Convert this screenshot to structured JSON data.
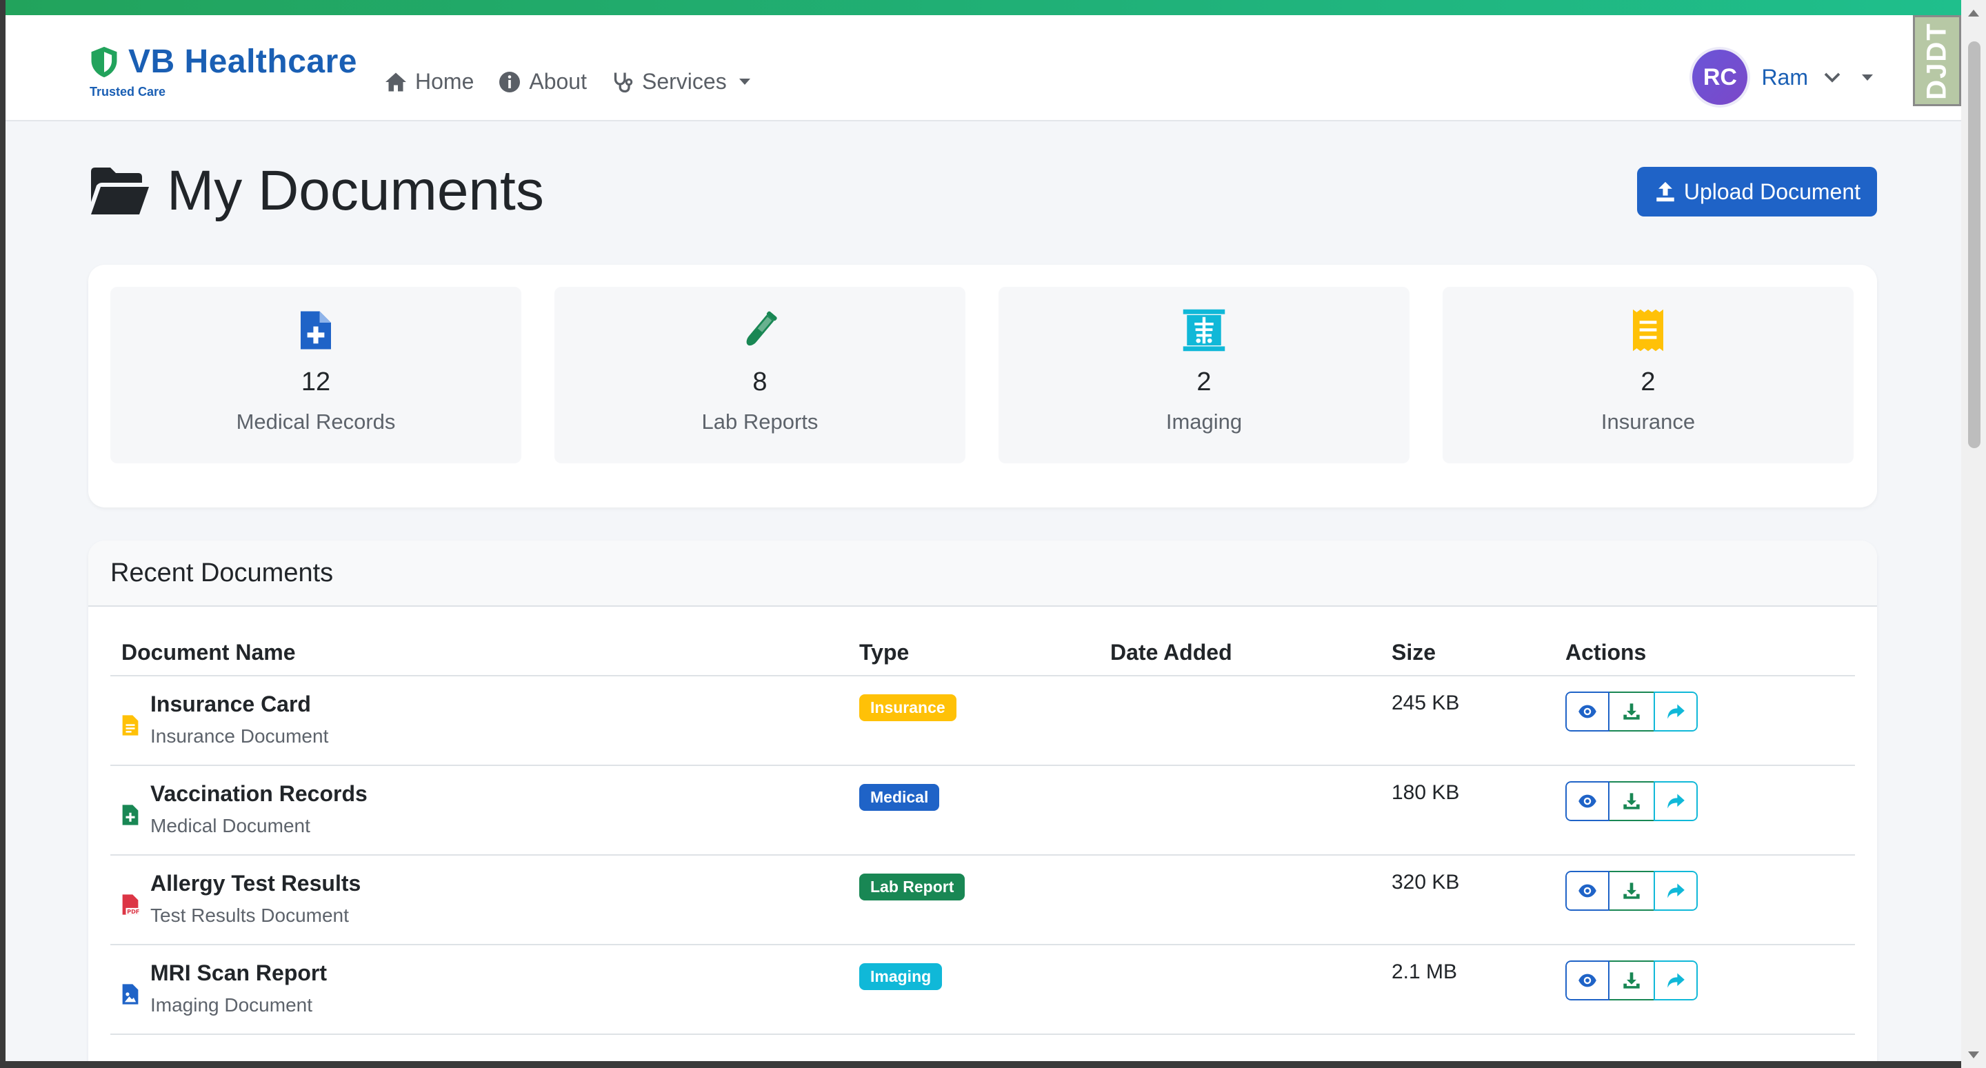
{
  "brand": {
    "name": "VB Healthcare",
    "tagline": "Trusted Care"
  },
  "nav": {
    "home": "Home",
    "about": "About",
    "services": "Services"
  },
  "user": {
    "initials": "RC",
    "name": "Ram"
  },
  "extension_badge": "DJDT",
  "page": {
    "title": "My Documents",
    "upload_label": "Upload Document"
  },
  "stats": [
    {
      "count": "12",
      "label": "Medical Records",
      "icon": "file-medical-icon",
      "color": "#1f63c7"
    },
    {
      "count": "8",
      "label": "Lab Reports",
      "icon": "vial-icon",
      "color": "#198754"
    },
    {
      "count": "2",
      "label": "Imaging",
      "icon": "x-ray-icon",
      "color": "#10b8d8"
    },
    {
      "count": "2",
      "label": "Insurance",
      "icon": "receipt-icon",
      "color": "#ffc107"
    }
  ],
  "recent": {
    "title": "Recent Documents",
    "columns": [
      "Document Name",
      "Type",
      "Date Added",
      "Size",
      "Actions"
    ],
    "rows": [
      {
        "name": "Insurance Card",
        "sub": "Insurance Document",
        "type": "Insurance",
        "date": "",
        "size": "245 KB",
        "icon": "file-invoice-icon",
        "icon_color": "#ffc107",
        "pill_color": "#ffc107"
      },
      {
        "name": "Vaccination Records",
        "sub": "Medical Document",
        "type": "Medical",
        "date": "",
        "size": "180 KB",
        "icon": "file-medical-icon",
        "icon_color": "#198754",
        "pill_color": "#1f63c7"
      },
      {
        "name": "Allergy Test Results",
        "sub": "Test Results Document",
        "type": "Lab Report",
        "date": "",
        "size": "320 KB",
        "icon": "file-pdf-icon",
        "icon_color": "#dc3545",
        "pill_color": "#198754"
      },
      {
        "name": "MRI Scan Report",
        "sub": "Imaging Document",
        "type": "Imaging",
        "date": "",
        "size": "2.1 MB",
        "icon": "file-image-icon",
        "icon_color": "#1f63c7",
        "pill_color": "#10b8d8"
      }
    ]
  },
  "colors": {
    "primary": "#1f63c7",
    "success": "#198754",
    "info": "#10b8d8",
    "warning": "#ffc107",
    "danger": "#dc3545",
    "accent_bar": "#22a35c"
  }
}
